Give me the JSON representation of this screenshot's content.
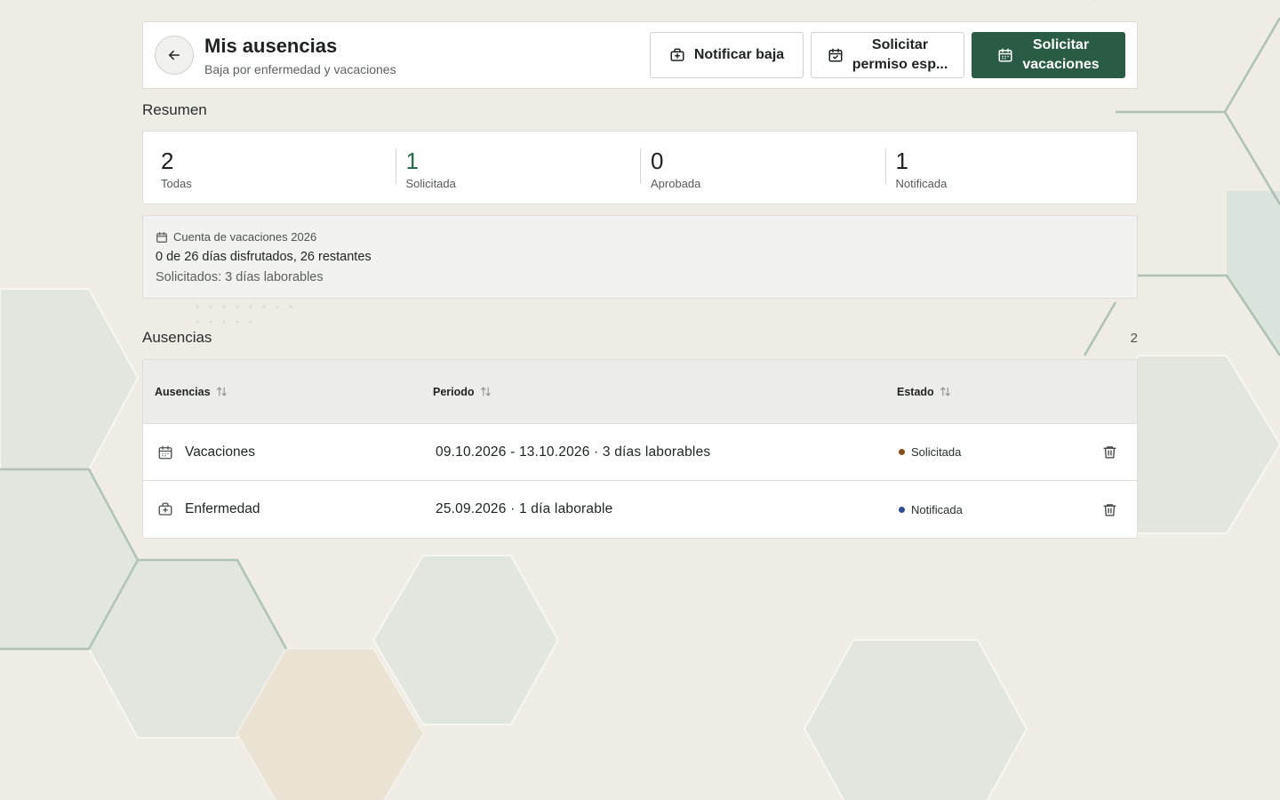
{
  "header": {
    "title": "Mis ausencias",
    "subtitle": "Baja por enfermedad y vacaciones",
    "back_icon": "arrow-left-icon",
    "actions": {
      "notify_label": "Notificar baja",
      "permit_label_1": "Solicitar",
      "permit_label_2": "permiso esp...",
      "vacation_label_1": "Solicitar",
      "vacation_label_2": "vacaciones"
    }
  },
  "summary": {
    "title": "Resumen",
    "stats": [
      {
        "value": "2",
        "label": "Todas"
      },
      {
        "value": "1",
        "label": "Solicitada"
      },
      {
        "value": "0",
        "label": "Aprobada"
      },
      {
        "value": "1",
        "label": "Notificada"
      }
    ]
  },
  "balance": {
    "heading": "Cuenta de vacaciones 2026",
    "main": "0 de 26 días disfrutados, 26 restantes",
    "sub": "Solicitados: 3 días laborables"
  },
  "absences": {
    "title": "Ausencias",
    "count": "2",
    "columns": {
      "type": "Ausencias",
      "period": "Periodo",
      "status": "Estado"
    },
    "rows": [
      {
        "type": "Vacaciones",
        "icon": "calendar-icon",
        "period": "09.10.2026 - 13.10.2026 · 3 días laborables",
        "status": "Solicitada",
        "status_color": "#8a4f1c"
      },
      {
        "type": "Enfermedad",
        "icon": "medical-kit-icon",
        "period": "25.09.2026 · 1 día laborable",
        "status": "Notificada",
        "status_color": "#2f4e96"
      }
    ]
  },
  "colors": {
    "primary": "#2a5c45",
    "accent_text": "#2a6b4c"
  }
}
